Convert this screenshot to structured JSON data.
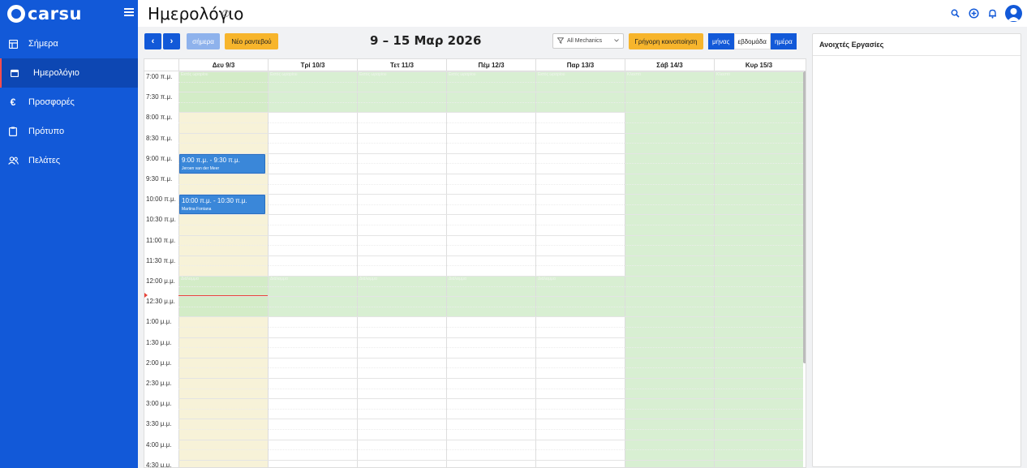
{
  "app": {
    "logo_text": "carsu"
  },
  "sidebar": {
    "items": [
      {
        "label": "Σήμερα",
        "icon": "dashboard-icon"
      },
      {
        "label": "Ημερολόγιο",
        "icon": "calendar-icon",
        "active": true
      },
      {
        "label": "Προσφορές",
        "icon": "euro-icon"
      },
      {
        "label": "Πρότυπο",
        "icon": "clipboard-icon"
      },
      {
        "label": "Πελάτες",
        "icon": "users-icon"
      }
    ]
  },
  "header": {
    "title": "Ημερολόγιο",
    "icons": [
      "search-icon",
      "add-circle-icon",
      "bell-icon",
      "avatar-icon"
    ]
  },
  "toolbar": {
    "today_label": "σήμερα",
    "new_appointment_label": "Νέο ραντεβού",
    "range_title": "9 – 15 Μαρ 2026",
    "mechanics_filter": "All Mechanics",
    "quick_notify_label": "Γρήγορη κοινοποίηση",
    "views": [
      "μήνας",
      "εβδομάδα",
      "ημέρα"
    ]
  },
  "calendar": {
    "days": [
      "Δευ 9/3",
      "Τρί 10/3",
      "Τετ 11/3",
      "Πέμ 12/3",
      "Παρ 13/3",
      "Σάβ 14/3",
      "Κυρ 15/3"
    ],
    "times": [
      "7:00 π.μ.",
      "7:30 π.μ.",
      "8:00 π.μ.",
      "8:30 π.μ.",
      "9:00 π.μ.",
      "9:30 π.μ.",
      "10:00 π.μ.",
      "10:30 π.μ.",
      "11:00 π.μ.",
      "11:30 π.μ.",
      "12:00 μ.μ.",
      "12:30 μ.μ.",
      "1:00 μ.μ.",
      "1:30 μ.μ.",
      "2:00 μ.μ.",
      "2:30 μ.μ.",
      "3:00 μ.μ.",
      "3:30 μ.μ.",
      "4:00 μ.μ.",
      "4:30 μ.μ."
    ],
    "closed_label": "Εκτός ωραρίου",
    "break_label": "Διάλειμμα",
    "weekend_label": "Κλειστό",
    "events": [
      {
        "time": "9:00 π.μ. - 9:30 π.μ.",
        "name": "Jeroen van der Meer"
      },
      {
        "time": "10:00 π.μ. - 10:30 π.μ.",
        "name": "Martina Fontana"
      }
    ],
    "colors": {
      "today": "#f7f2d8",
      "closed": "#d8efd2",
      "today_closed": "#d3ecc7",
      "event": "#3a87d9",
      "now": "#e8443a"
    }
  },
  "panel": {
    "title": "Ανοιχτές Εργασίες"
  }
}
